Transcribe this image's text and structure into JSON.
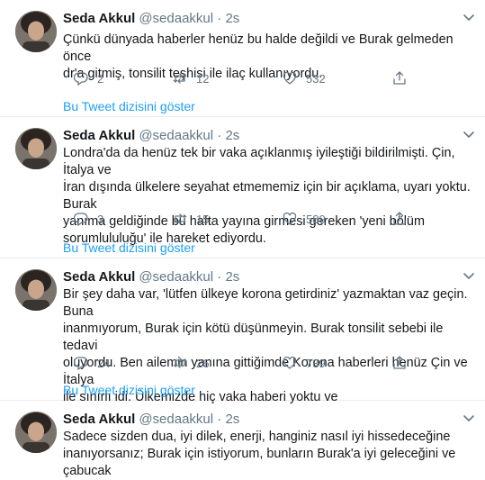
{
  "tweets": [
    {
      "name": "Seda Akkul",
      "handle": "@sedaakkul",
      "dot": "·",
      "time": "2s",
      "lines": [
        "Çünkü dünyada haberler henüz bu halde değildi ve Burak gelmeden önce",
        "dr'a gitmiş, tonsilit teşhisi ile ilaç kullanıyordu."
      ],
      "replies": "2",
      "retweets": "12",
      "likes": "532",
      "show_thread": "Bu Tweet dizisini göster"
    },
    {
      "name": "Seda Akkul",
      "handle": "@sedaakkul",
      "dot": "·",
      "time": "2s",
      "lines": [
        "Londra'da da henüz tek bir vaka açıklanmış iyileştiği bildirilmişti. Çin, İtalya ve",
        "İran dışında ülkelere seyahat etmememiz için bir açıklama, uyarı yoktu. Burak",
        "yanıma geldiğinde bu hafta yayına girmesi gereken 'yeni bölüm",
        "sorumlululuğu' ile hareket ediyordu."
      ],
      "replies": "3",
      "retweets": "15",
      "likes": "589",
      "show_thread": "Bu Tweet dizisini göster"
    },
    {
      "name": "Seda Akkul",
      "handle": "@sedaakkul",
      "dot": "·",
      "time": "2s",
      "lines": [
        "Bir şey daha var, 'lütfen ülkeye korona getirdiniz' yazmaktan vaz geçin. Buna",
        "inanmıyorum, Burak için kötü düşünmeyin. Burak tonsilit sebebi ile tedavi",
        "oluyordu. Ben ailemin yanına gittiğimde Korona haberleri henüz Çin ve İtalya",
        "ile sınırlı idi. Ülkemizde hiç vaka haberi yoktu ve"
      ],
      "replies": "24",
      "retweets": "26",
      "likes": "739",
      "show_thread": "Bu Tweet dizisini göster"
    },
    {
      "name": "Seda Akkul",
      "handle": "@sedaakkul",
      "dot": "·",
      "time": "2s",
      "lines": [
        "Sadece sizden dua, iyi dilek, enerji, hanginiz nasıl iyi hissedeceğine",
        "inanıyorsanız; Burak için istiyorum, bunların Burak'a iyi geleceğini  ve çabucak"
      ]
    }
  ],
  "colors": {
    "link": "#1da1f2",
    "muted": "#657786",
    "divider": "#e6ecf0"
  },
  "icons": [
    "reply-icon",
    "retweet-icon",
    "like-icon",
    "share-icon",
    "chevron-down-icon"
  ]
}
